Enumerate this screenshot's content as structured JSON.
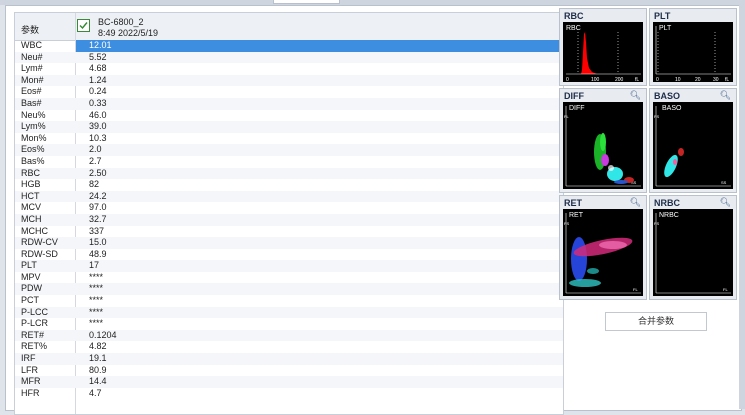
{
  "table": {
    "header_param": "参数",
    "sample_id": "BC-6800_2",
    "sample_time": "8:49 2022/5/19",
    "rows": [
      {
        "name": "WBC",
        "value": "12.01"
      },
      {
        "name": "Neu#",
        "value": "5.52"
      },
      {
        "name": "Lym#",
        "value": "4.68"
      },
      {
        "name": "Mon#",
        "value": "1.24"
      },
      {
        "name": "Eos#",
        "value": "0.24"
      },
      {
        "name": "Bas#",
        "value": "0.33"
      },
      {
        "name": "Neu%",
        "value": "46.0"
      },
      {
        "name": "Lym%",
        "value": "39.0"
      },
      {
        "name": "Mon%",
        "value": "10.3"
      },
      {
        "name": "Eos%",
        "value": "2.0"
      },
      {
        "name": "Bas%",
        "value": "2.7"
      },
      {
        "name": "RBC",
        "value": "2.50"
      },
      {
        "name": "HGB",
        "value": "82"
      },
      {
        "name": "HCT",
        "value": "24.2"
      },
      {
        "name": "MCV",
        "value": "97.0"
      },
      {
        "name": "MCH",
        "value": "32.7"
      },
      {
        "name": "MCHC",
        "value": "337"
      },
      {
        "name": "RDW-CV",
        "value": "15.0"
      },
      {
        "name": "RDW-SD",
        "value": "48.9"
      },
      {
        "name": "PLT",
        "value": "17"
      },
      {
        "name": "MPV",
        "value": "****"
      },
      {
        "name": "PDW",
        "value": "****"
      },
      {
        "name": "PCT",
        "value": "****"
      },
      {
        "name": "P-LCC",
        "value": "****"
      },
      {
        "name": "P-LCR",
        "value": "****"
      },
      {
        "name": "RET#",
        "value": "0.1204"
      },
      {
        "name": "RET%",
        "value": "4.82"
      },
      {
        "name": "IRF",
        "value": "19.1"
      },
      {
        "name": "LFR",
        "value": "80.9"
      },
      {
        "name": "MFR",
        "value": "14.4"
      },
      {
        "name": "HFR",
        "value": "4.7"
      }
    ]
  },
  "panels": {
    "rbc": {
      "title": "RBC",
      "label": "RBC",
      "ticks": [
        "0",
        "100",
        "200",
        "fL"
      ]
    },
    "plt": {
      "title": "PLT",
      "label": "PLT",
      "ticks": [
        "0",
        "10",
        "20",
        "30",
        "fL"
      ]
    },
    "diff": {
      "title": "DIFF",
      "label": "DIFF",
      "xaxis": "SS",
      "yaxis": "FL"
    },
    "baso": {
      "title": "BASO",
      "label": "BASO",
      "xaxis": "SS",
      "yaxis": "FS"
    },
    "ret": {
      "title": "RET",
      "label": "RET",
      "xaxis": "FL",
      "yaxis": "FS"
    },
    "nrbc": {
      "title": "NRBC",
      "label": "NRBC",
      "xaxis": "FL",
      "yaxis": "FS"
    }
  },
  "merge_button": "合并参数",
  "colors": {
    "selected_row": "#3d8ee0",
    "rbc_curve": "#ff0000",
    "panel_bg": "#e8ebef"
  }
}
